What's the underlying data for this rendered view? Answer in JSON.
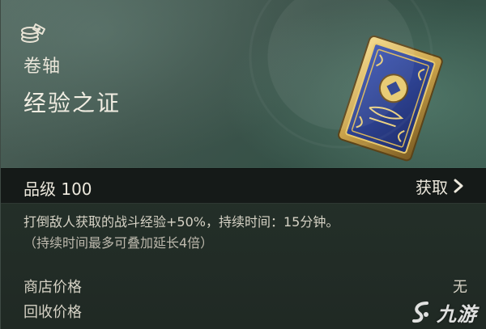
{
  "item": {
    "category": "卷轴",
    "name": "经验之证",
    "type_icon": "coins-scroll-icon",
    "art_icon": "gilded-card-icon"
  },
  "grade": {
    "label": "品级 100"
  },
  "acquire": {
    "label": "获取",
    "icon": "chevron-right-icon"
  },
  "description": {
    "line1": "打倒敌人获取的战斗经验+50%，持续时间：15分钟。",
    "line2": "（持续时间最多可叠加延长4倍）"
  },
  "prices": {
    "shop_label": "商店价格",
    "shop_value": "无",
    "recycle_label": "回收价格"
  },
  "watermark": {
    "text": "九游",
    "icon": "jiuyou-logo-icon"
  },
  "colors": {
    "hero_teal": "#3f544c",
    "grade_bar": "#151a18",
    "card_blue": "#2a3f8c",
    "card_gold": "#c9a24a"
  }
}
